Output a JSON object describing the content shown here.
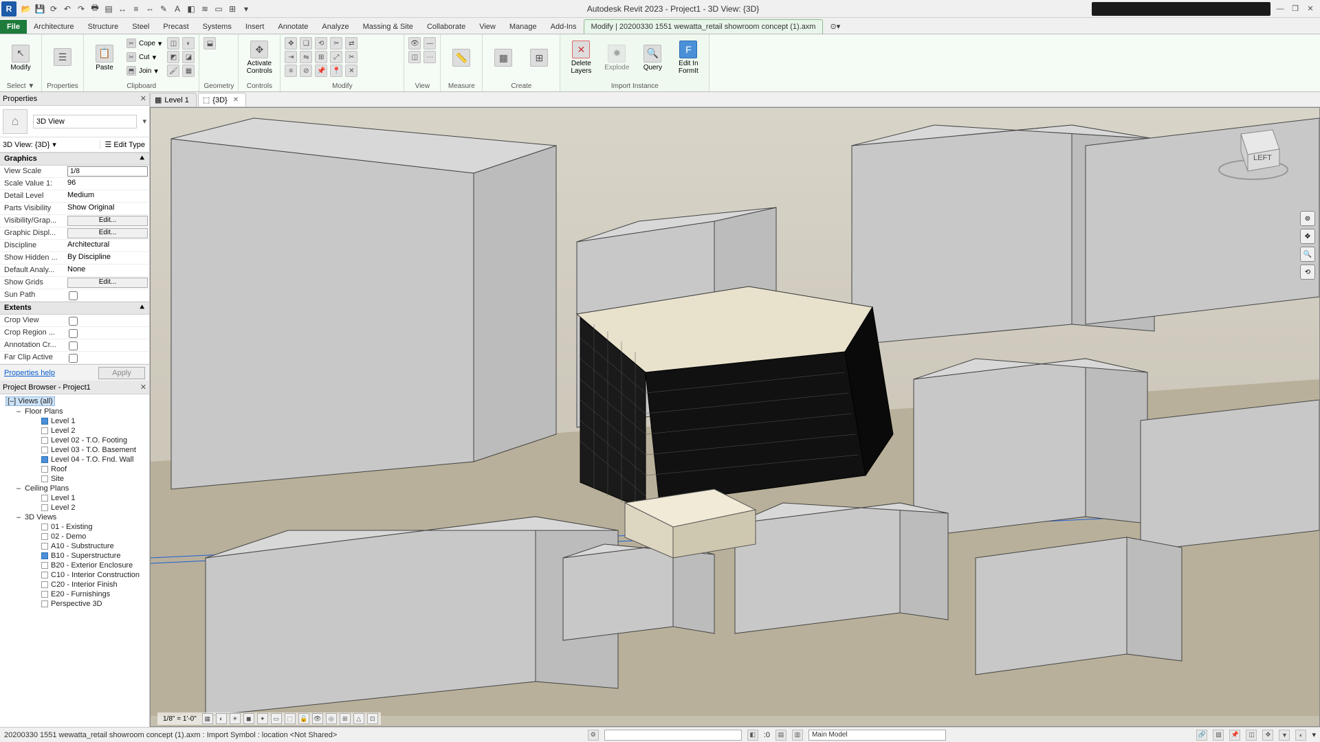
{
  "titlebar": {
    "app_title": "Autodesk Revit 2023 - Project1 - 3D View: {3D}",
    "logo": "R"
  },
  "qat_icons": [
    "open",
    "save",
    "sync",
    "undo",
    "redo",
    "sep",
    "print",
    "pdf",
    "measure",
    "align",
    "dim",
    "tag",
    "text",
    "region",
    "thin",
    "switch",
    "close",
    "tile"
  ],
  "win_controls": [
    "min",
    "restore",
    "close"
  ],
  "ribbon": {
    "tabs": [
      "File",
      "Architecture",
      "Structure",
      "Steel",
      "Precast",
      "Systems",
      "Insert",
      "Annotate",
      "Analyze",
      "Massing & Site",
      "Collaborate",
      "View",
      "Manage",
      "Add-Ins",
      "Modify | 20200330 1551 wewatta_retail showroom concept (1).axm"
    ],
    "active_index": 14,
    "groups": {
      "select": {
        "label": "Select ▼",
        "items": [
          "Modify"
        ]
      },
      "properties": {
        "label": "Properties"
      },
      "clipboard": {
        "label": "Clipboard",
        "big": "Paste",
        "small": [
          "Cope",
          "Cut",
          "Join"
        ]
      },
      "geometry": {
        "label": "Geometry"
      },
      "controls": {
        "label": "Controls",
        "big": "Activate\nControls"
      },
      "modify": {
        "label": "Modify"
      },
      "view": {
        "label": "View"
      },
      "measure": {
        "label": "Measure"
      },
      "create": {
        "label": "Create"
      },
      "import": {
        "label": "Import Instance",
        "buttons": [
          {
            "name": "delete-layers",
            "label": "Delete\nLayers"
          },
          {
            "name": "explode",
            "label": "Explode"
          },
          {
            "name": "query",
            "label": "Query"
          },
          {
            "name": "edit-formit",
            "label": "Edit In\nFormIt"
          }
        ]
      }
    }
  },
  "view_tabs": [
    {
      "icon": "plan",
      "label": "Level 1",
      "active": false,
      "closable": false
    },
    {
      "icon": "3d",
      "label": "{3D}",
      "active": true,
      "closable": true
    }
  ],
  "properties_panel": {
    "title": "Properties",
    "type_selector": "3D View",
    "instance": "3D View: {3D}",
    "edit_type": "Edit Type",
    "sections": [
      {
        "name": "Graphics",
        "rows": [
          {
            "k": "View Scale",
            "v": "1/8\" = 1'-0\"",
            "type": "input"
          },
          {
            "k": "Scale Value   1:",
            "v": "96",
            "type": "text"
          },
          {
            "k": "Detail Level",
            "v": "Medium",
            "type": "text"
          },
          {
            "k": "Parts Visibility",
            "v": "Show Original",
            "type": "text"
          },
          {
            "k": "Visibility/Grap...",
            "v": "Edit...",
            "type": "button"
          },
          {
            "k": "Graphic Displ...",
            "v": "Edit...",
            "type": "button"
          },
          {
            "k": "Discipline",
            "v": "Architectural",
            "type": "text"
          },
          {
            "k": "Show Hidden ...",
            "v": "By Discipline",
            "type": "text"
          },
          {
            "k": "Default Analy...",
            "v": "None",
            "type": "text"
          },
          {
            "k": "Show Grids",
            "v": "Edit...",
            "type": "button"
          },
          {
            "k": "Sun Path",
            "v": "",
            "type": "check",
            "checked": false
          }
        ]
      },
      {
        "name": "Extents",
        "rows": [
          {
            "k": "Crop View",
            "v": "",
            "type": "check",
            "checked": false
          },
          {
            "k": "Crop Region ...",
            "v": "",
            "type": "check",
            "checked": false
          },
          {
            "k": "Annotation Cr...",
            "v": "",
            "type": "check",
            "checked": false
          },
          {
            "k": "Far Clip Active",
            "v": "",
            "type": "check",
            "checked": false
          }
        ]
      }
    ],
    "help": "Properties help",
    "apply": "Apply"
  },
  "project_browser": {
    "title": "Project Browser - Project1",
    "tree": [
      {
        "l": 0,
        "t": "[–] Views (all)",
        "sel": true
      },
      {
        "l": 1,
        "t": "Floor Plans"
      },
      {
        "l": 2,
        "t": "Level 1",
        "ic": "blue"
      },
      {
        "l": 2,
        "t": "Level 2"
      },
      {
        "l": 2,
        "t": "Level 02 - T.O. Footing"
      },
      {
        "l": 2,
        "t": "Level 03 - T.O. Basement"
      },
      {
        "l": 2,
        "t": "Level 04 - T.O. Fnd. Wall",
        "ic": "blue"
      },
      {
        "l": 2,
        "t": "Roof"
      },
      {
        "l": 2,
        "t": "Site"
      },
      {
        "l": 1,
        "t": "Ceiling Plans"
      },
      {
        "l": 2,
        "t": "Level 1"
      },
      {
        "l": 2,
        "t": "Level 2"
      },
      {
        "l": 1,
        "t": "3D Views"
      },
      {
        "l": 2,
        "t": "01 - Existing"
      },
      {
        "l": 2,
        "t": "02 - Demo"
      },
      {
        "l": 2,
        "t": "A10 - Substructure"
      },
      {
        "l": 2,
        "t": "B10 - Superstructure",
        "ic": "blue"
      },
      {
        "l": 2,
        "t": "B20 - Exterior Enclosure"
      },
      {
        "l": 2,
        "t": "C10 - Interior Construction"
      },
      {
        "l": 2,
        "t": "C20 - Interior Finish"
      },
      {
        "l": 2,
        "t": "E20 - Furnishings"
      },
      {
        "l": 2,
        "t": "Perspective 3D"
      }
    ]
  },
  "view_control_bar": {
    "scale": "1/8\" = 1'-0\"",
    "icons": [
      "detail",
      "style",
      "sun",
      "shadow",
      "render",
      "crop",
      "show-crop",
      "lock",
      "temp",
      "reveal",
      "constraints",
      "analytical",
      "worksharing"
    ]
  },
  "navcube": {
    "face": "LEFT"
  },
  "statusbar": {
    "message": "20200330 1551 wewatta_retail showroom concept (1).axm : Import Symbol : location <Not Shared>",
    "workset": "Main Model",
    "zero": ":0",
    "right_icons": [
      "select-links",
      "select-underlay",
      "select-pinned",
      "select-face",
      "drag",
      "filter",
      "bg",
      "editable"
    ]
  }
}
